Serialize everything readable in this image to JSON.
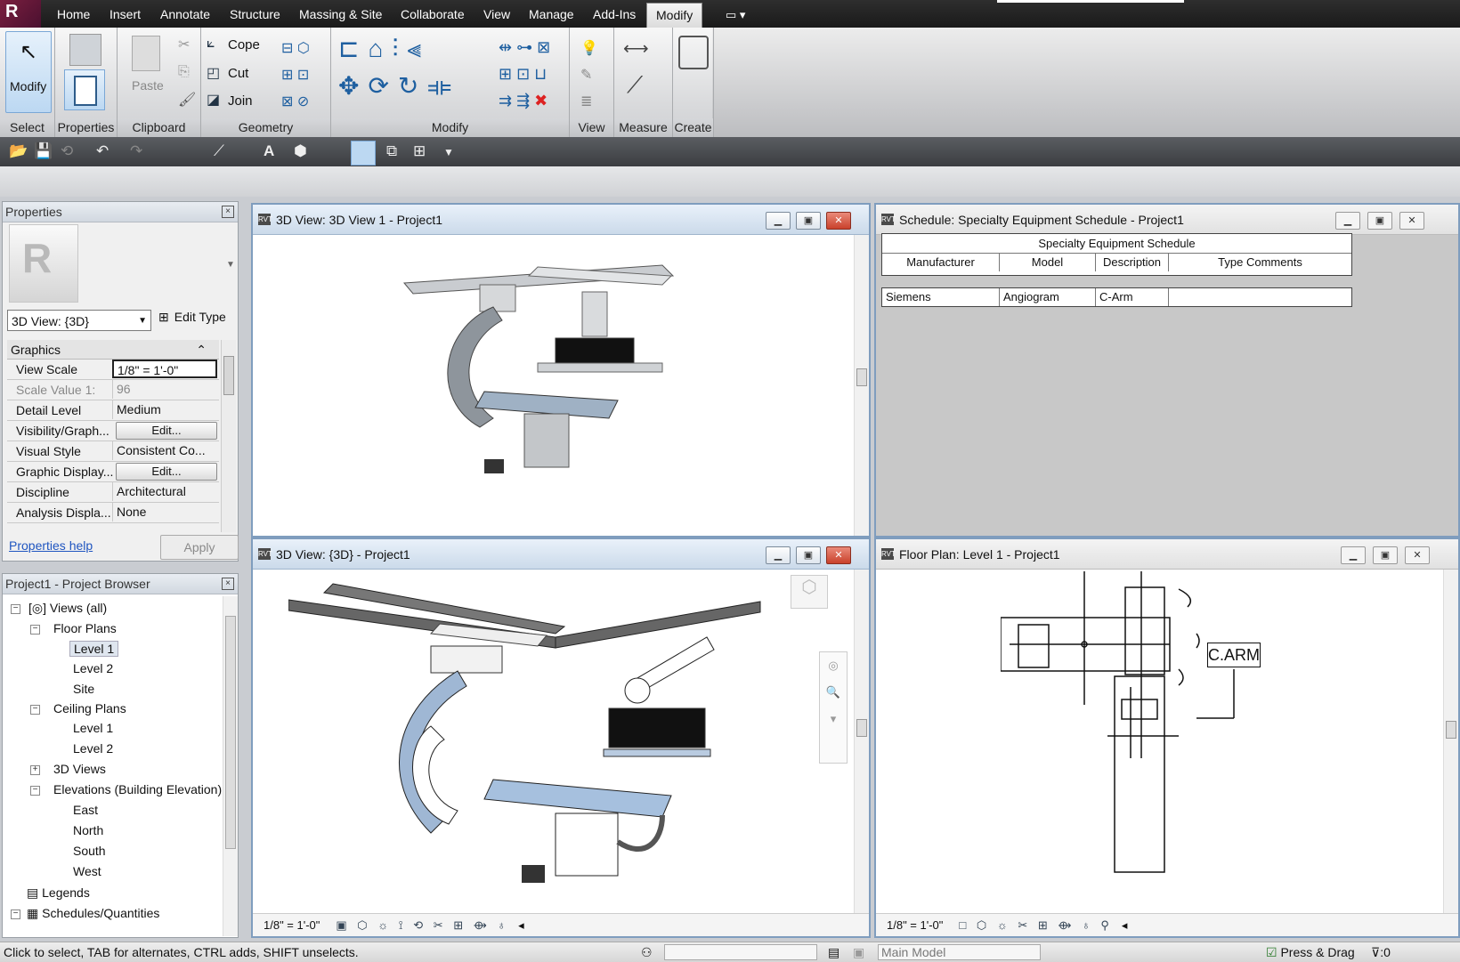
{
  "ribbon": {
    "tabs": [
      "Home",
      "Insert",
      "Annotate",
      "Structure",
      "Massing & Site",
      "Collaborate",
      "View",
      "Manage",
      "Add-Ins",
      "Modify"
    ],
    "active_tab": "Modify",
    "modify_label": "Modify",
    "paste_label": "Paste",
    "cope_label": "Cope",
    "cut_label": "Cut",
    "join_label": "Join",
    "panels": [
      "Select",
      "Properties",
      "Clipboard",
      "Geometry",
      "Modify",
      "View",
      "Measure",
      "Create"
    ]
  },
  "properties": {
    "title": "Properties",
    "type_selector": "3D View: {3D}",
    "edit_type": "Edit Type",
    "section": "Graphics",
    "rows": [
      {
        "key": "View Scale",
        "value": "1/8\" = 1'-0\""
      },
      {
        "key": "Scale Value    1:",
        "value": "96"
      },
      {
        "key": "Detail Level",
        "value": "Medium"
      },
      {
        "key": "Visibility/Graph...",
        "value": "Edit..."
      },
      {
        "key": "Visual Style",
        "value": "Consistent Co..."
      },
      {
        "key": "Graphic Display...",
        "value": "Edit..."
      },
      {
        "key": "Discipline",
        "value": "Architectural"
      },
      {
        "key": "Analysis Displa...",
        "value": "None"
      }
    ],
    "help_link": "Properties help",
    "apply": "Apply"
  },
  "browser": {
    "title": "Project1 - Project Browser",
    "nodes": [
      "Views (all)",
      "Floor Plans",
      "Level 1",
      "Level 2",
      "Site",
      "Ceiling Plans",
      "Level 1",
      "Level 2",
      "3D Views",
      "Elevations (Building Elevation)",
      "East",
      "North",
      "South",
      "West",
      "Legends",
      "Schedules/Quantities"
    ]
  },
  "views": {
    "v1_title": "3D View: 3D View 1 - Project1",
    "v2_title": "3D View: {3D} - Project1",
    "v3_title": "Schedule: Specialty Equipment Schedule - Project1",
    "v4_title": "Floor Plan: Level 1 - Project1",
    "scale": "1/8\" = 1'-0\"",
    "plan_tag": "C.ARM"
  },
  "schedule": {
    "title": "Specialty Equipment Schedule",
    "headers": [
      "Manufacturer",
      "Model",
      "Description",
      "Type Comments"
    ],
    "row": [
      "Siemens",
      "Angiogram",
      "C-Arm",
      ""
    ]
  },
  "status": {
    "hint": "Click to select, TAB for alternates, CTRL adds, SHIFT unselects.",
    "model": "Main Model",
    "press_drag": "Press & Drag",
    "filter": ":0"
  }
}
